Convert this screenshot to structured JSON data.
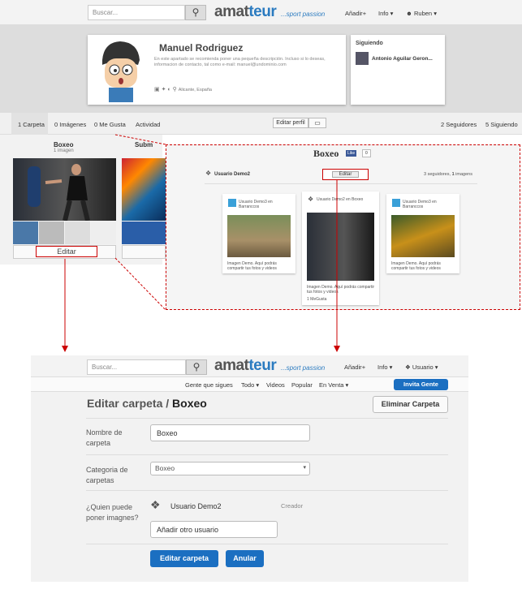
{
  "topnav": {
    "search_placeholder": "Buscar...",
    "logo_a": "amat",
    "logo_b": "teur",
    "tagline": "...sport passion",
    "add": "Añadir",
    "add_arrow": "+",
    "info": "Info",
    "user": "Ruben"
  },
  "profile": {
    "name": "Manuel Rodriguez",
    "description": "En este apartado se recomienda poner una pequeña descripción. Incluso si lo deseas, informacion de contacto, tal como e-mail: manuel@undominio.com",
    "location": "Alicante, España"
  },
  "following": {
    "title": "Siguiendo",
    "name": "Antonio Aguilar Geron..."
  },
  "tabs": {
    "carpeta": "1 Carpeta",
    "imagenes": "0 Imágenes",
    "megusta": "0 Me Gusta",
    "actividad": "Actividad",
    "edit_profile": "Editar perfil",
    "seguidores": "2 Seguidores",
    "siguiendo": "5 Siguiendo"
  },
  "folders": [
    {
      "title": "Boxeo",
      "count": "1 imagen",
      "edit": "Editar"
    },
    {
      "title": "Subm"
    }
  ],
  "board": {
    "title": "Boxeo",
    "like": "Like",
    "like_count": "0",
    "user": "Usuario Demo2",
    "edit": "Editar",
    "stats_a": "3 seguidores, ",
    "stats_b": "1",
    "stats_c": " imagens"
  },
  "pins": [
    {
      "user": "Usuario Demo3 en Barranccos",
      "desc": "Imagen Demo. Aquí podrás compartir tus fotos y videos",
      "likes": ""
    },
    {
      "user": "Usuario Demo2 en Boxeo",
      "desc": "Imagen Demo. Aquí podrás compartir tus fotos y videos",
      "likes": "1 MeGusta"
    },
    {
      "user": "Usuario Demo3 en Barranccos",
      "desc": "Imagen Demo. Aquí podrás compartir tus fotos y videos",
      "likes": ""
    }
  ],
  "subnav": {
    "gente": "Gente que sigues",
    "todo": "Todo",
    "videos": "Videos",
    "popular": "Popular",
    "venta": "En Venta",
    "invita": "Invita Gente"
  },
  "form": {
    "title_a": "Editar carpeta / ",
    "title_b": "Boxeo",
    "delete": "Eliminar Carpeta",
    "name_label": "Nombre de carpeta",
    "name_value": "Boxeo",
    "cat_label": "Categoria de carpetas",
    "cat_value": "Boxeo",
    "who_label": "¿Quien puede poner imagnes?",
    "owner": "Usuario Demo2",
    "owner_role": "Creador",
    "add_user": "Añadir otro usuario",
    "submit": "Editar carpeta",
    "cancel": "Anular"
  },
  "colors": {
    "accent": "#1b6fc1",
    "annotation": "#cc0000"
  }
}
